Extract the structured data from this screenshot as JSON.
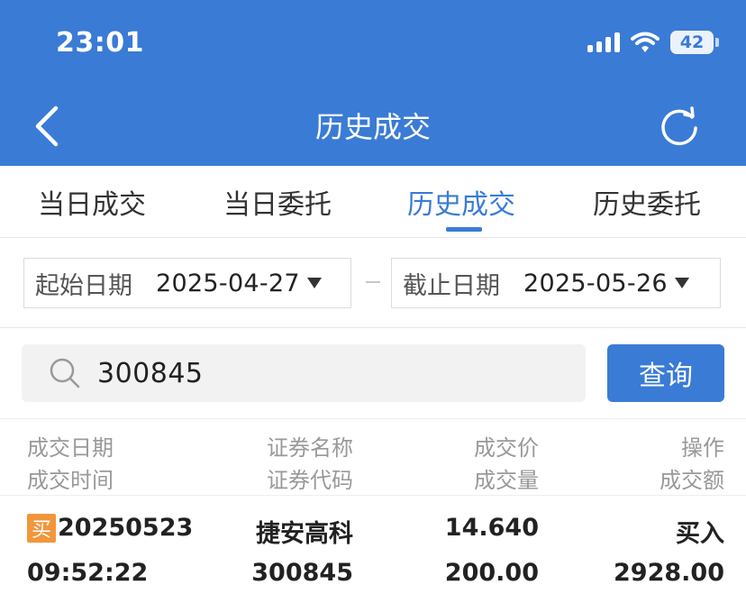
{
  "status_bar": {
    "time": "23:01",
    "battery": "42"
  },
  "nav": {
    "title": "历史成交"
  },
  "tabs": [
    {
      "label": "当日成交",
      "active": false
    },
    {
      "label": "当日委托",
      "active": false
    },
    {
      "label": "历史成交",
      "active": true
    },
    {
      "label": "历史委托",
      "active": false
    }
  ],
  "date_filter": {
    "start_label": "起始日期",
    "start_value": "2025-04-27",
    "end_label": "截止日期",
    "end_value": "2025-05-26"
  },
  "search": {
    "value": "300845",
    "button_label": "查询"
  },
  "table": {
    "headers": {
      "col1_line1": "成交日期",
      "col1_line2": "成交时间",
      "col2_line1": "证券名称",
      "col2_line2": "证券代码",
      "col3_line1": "成交价",
      "col3_line2": "成交量",
      "col4_line1": "操作",
      "col4_line2": "成交额"
    },
    "rows": [
      {
        "badge": "买",
        "date": "20250523",
        "time": "09:52:22",
        "name": "捷安高科",
        "code": "300845",
        "price": "14.640",
        "volume": "200.00",
        "action": "买入",
        "amount": "2928.00"
      }
    ]
  },
  "colors": {
    "brand": "#3a7bd5",
    "buy_badge": "#f2963c"
  }
}
